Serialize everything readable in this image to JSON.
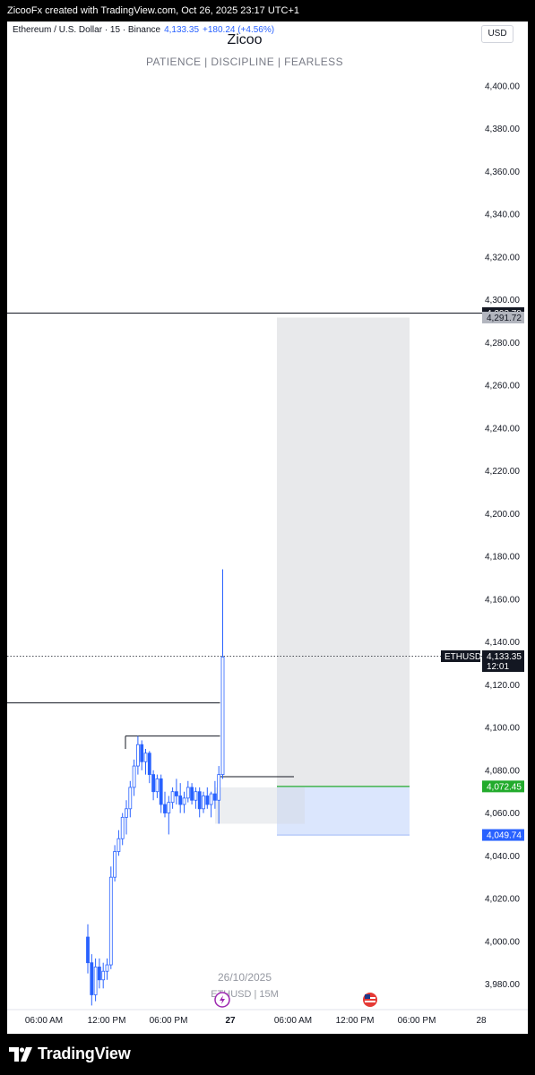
{
  "header": {
    "credit": "ZicooFx created with TradingView.com, Oct 26, 2025 23:17 UTC+1"
  },
  "legend": {
    "symbol_desc": "Ethereum / U.S. Dollar · 15 · Binance",
    "last_price": "4,133.35",
    "change": "+180.24 (+4.56%)"
  },
  "currency": "USD",
  "watermark": {
    "title": "Zicoo",
    "subtitle": "PATIENCE  |  DISCIPLINE  |  FEARLESS",
    "date": "26/10/2025",
    "symbol": "ETHUSD | 15M"
  },
  "footer": {
    "brand": "TradingView"
  },
  "colors": {
    "candle": "#2962ff",
    "target_zone": "#e8e9eb",
    "stop_zone": "#dbe6fd",
    "entry_line": "#22ab2c",
    "stop_tag": "#2962ff",
    "level_tag": "#131722"
  },
  "chart_data": {
    "type": "candlestick",
    "title": "Zicoo",
    "ylim": [
      3970,
      4430
    ],
    "y_ticks": [
      "4,400.00",
      "4,380.00",
      "4,360.00",
      "4,340.00",
      "4,320.00",
      "4,300.00",
      "4,280.00",
      "4,260.00",
      "4,240.00",
      "4,220.00",
      "4,200.00",
      "4,180.00",
      "4,160.00",
      "4,140.00",
      "4,120.00",
      "4,100.00",
      "4,080.00",
      "4,060.00",
      "4,040.00",
      "4,020.00",
      "4,000.00",
      "3,980.00"
    ],
    "x_ticks": [
      "06:00 AM",
      "12:00 PM",
      "06:00 PM",
      "27",
      "06:00 AM",
      "12:00 PM",
      "06:00 PM",
      "28"
    ],
    "price_tags": [
      {
        "label": "4,293.78",
        "kind": "level"
      },
      {
        "label": "4,291.72",
        "kind": "target"
      },
      {
        "label": "4,072.45",
        "kind": "entry"
      },
      {
        "label": "4,049.74",
        "kind": "stop"
      }
    ],
    "current_price": {
      "symbol": "ETHUSD",
      "price": "4,133.35",
      "countdown": "12:01"
    },
    "candles": [
      [
        4002,
        4008,
        3985,
        3990
      ],
      [
        3990,
        3994,
        3970,
        3975
      ],
      [
        3975,
        3992,
        3972,
        3988
      ],
      [
        3988,
        3992,
        3978,
        3982
      ],
      [
        3982,
        3990,
        3978,
        3986
      ],
      [
        3986,
        3992,
        3982,
        3989
      ],
      [
        3989,
        4035,
        3987,
        4030
      ],
      [
        4030,
        4045,
        4028,
        4042
      ],
      [
        4042,
        4052,
        4040,
        4048
      ],
      [
        4048,
        4060,
        4045,
        4058
      ],
      [
        4058,
        4066,
        4050,
        4062
      ],
      [
        4062,
        4075,
        4058,
        4072
      ],
      [
        4072,
        4085,
        4068,
        4082
      ],
      [
        4082,
        4096,
        4078,
        4092
      ],
      [
        4092,
        4094,
        4080,
        4084
      ],
      [
        4084,
        4090,
        4078,
        4088
      ],
      [
        4088,
        4089,
        4074,
        4078
      ],
      [
        4078,
        4080,
        4066,
        4070
      ],
      [
        4070,
        4078,
        4067,
        4076
      ],
      [
        4076,
        4078,
        4060,
        4064
      ],
      [
        4064,
        4070,
        4058,
        4060
      ],
      [
        4060,
        4068,
        4050,
        4065
      ],
      [
        4065,
        4072,
        4062,
        4070
      ],
      [
        4070,
        4076,
        4064,
        4068
      ],
      [
        4068,
        4074,
        4060,
        4064
      ],
      [
        4064,
        4070,
        4060,
        4067
      ],
      [
        4067,
        4075,
        4065,
        4072
      ],
      [
        4072,
        4074,
        4064,
        4066
      ],
      [
        4066,
        4072,
        4062,
        4070
      ],
      [
        4070,
        4072,
        4058,
        4062
      ],
      [
        4062,
        4070,
        4060,
        4068
      ],
      [
        4068,
        4072,
        4062,
        4064
      ],
      [
        4064,
        4070,
        4058,
        4069
      ],
      [
        4069,
        4075,
        4062,
        4066
      ],
      [
        4066,
        4082,
        4055,
        4078
      ],
      [
        4078,
        4174,
        4076,
        4133
      ]
    ],
    "levels": [
      {
        "price": 4293.78,
        "from": "start",
        "to": "end"
      },
      {
        "price": 4111.5,
        "from": "start",
        "to": "spike"
      },
      {
        "price": 4096,
        "from": "first_high",
        "to": "spike"
      },
      {
        "price": 4077,
        "from": "spike",
        "to": "position"
      }
    ],
    "position": {
      "target": 4291.72,
      "entry": 4072.45,
      "stop": 4049.74
    },
    "range_box": {
      "top": 4072,
      "bottom": 4055
    }
  }
}
